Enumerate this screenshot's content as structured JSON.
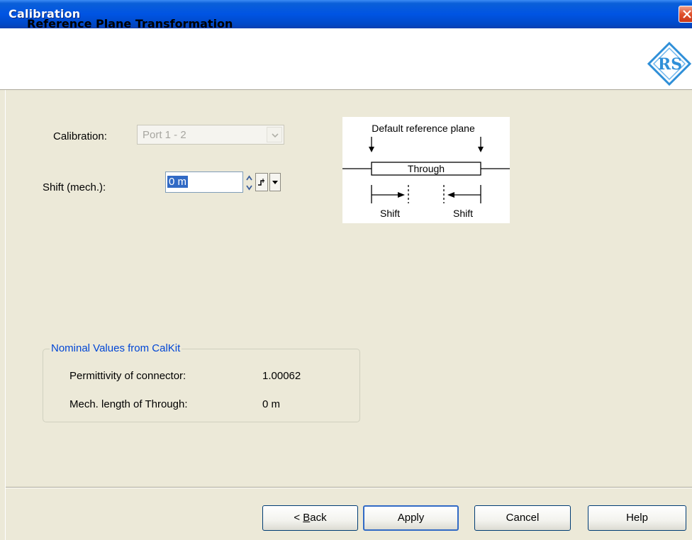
{
  "window": {
    "title": "Calibration"
  },
  "header": {
    "heading": "Reference Plane Transformation",
    "logo_text": "R&S"
  },
  "form": {
    "calibration_label": "Calibration:",
    "calibration_value": "Port 1 - 2",
    "shift_label": "Shift (mech.):",
    "shift_value": "0 m"
  },
  "diagram": {
    "title": "Default reference plane",
    "through_label": "Through",
    "shift_left_label": "Shift",
    "shift_right_label": "Shift"
  },
  "nominal": {
    "legend": "Nominal Values from CalKit",
    "permittivity_label": "Permittivity of connector:",
    "permittivity_value": "1.00062",
    "mech_length_label": "Mech. length of Through:",
    "mech_length_value": "0 m"
  },
  "buttons": {
    "back_prefix": "< ",
    "back_accel": "B",
    "back_rest": "ack",
    "apply": "Apply",
    "cancel": "Cancel",
    "help": "Help"
  },
  "icons": {
    "close": "close-icon",
    "logo": "rohde-schwarz-logo-icon",
    "combo_arrow": "chevron-down-icon",
    "spin_up": "spin-up-icon",
    "spin_down": "spin-down-icon",
    "step": "step-size-icon",
    "dropdown": "dropdown-arrow-icon"
  },
  "colors": {
    "titlebar": "#0054e3",
    "background": "#ece9d8",
    "group_legend": "#0046d5",
    "selection": "#316ac5"
  }
}
